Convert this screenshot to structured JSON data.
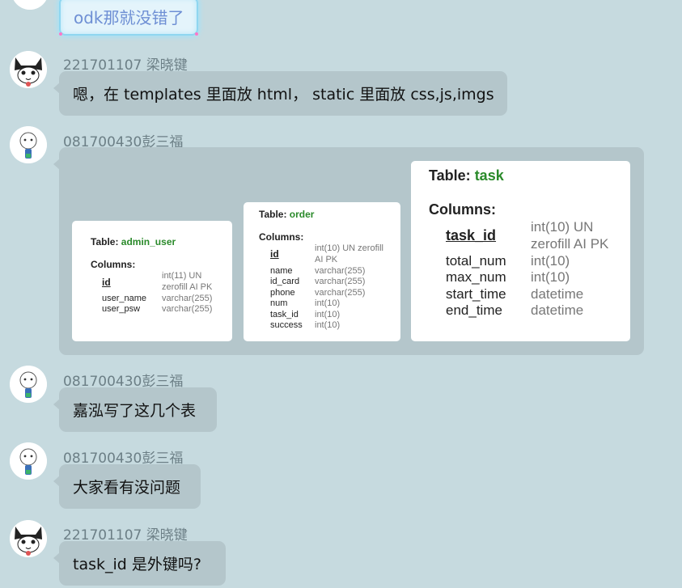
{
  "messages": [
    {
      "text": "odk那就没错了"
    },
    {
      "sender": "221701107 梁晓键",
      "text": "嗯，在 templates 里面放 html， static 里面放 css,js,imgs"
    },
    {
      "sender": "081700430彭三福"
    },
    {
      "sender": "081700430彭三福",
      "text": "嘉泓写了这几个表"
    },
    {
      "sender": "081700430彭三福",
      "text": "大家看有没问题"
    },
    {
      "sender": "221701107 梁晓键",
      "text": "task_id 是外键吗?"
    }
  ],
  "image": {
    "tables": [
      {
        "label": "Table:",
        "name": "admin_user",
        "columns_label": "Columns:",
        "columns": [
          {
            "name": "id",
            "type": "int(11) UN"
          },
          {
            "name": "",
            "type": "zerofill AI PK"
          },
          {
            "name": "user_name",
            "type": "varchar(255)"
          },
          {
            "name": "user_psw",
            "type": "varchar(255)"
          }
        ]
      },
      {
        "label": "Table:",
        "name": "order",
        "columns_label": "Columns:",
        "columns": [
          {
            "name": "id",
            "type": "int(10) UN zerofill"
          },
          {
            "name": "",
            "type": "AI PK"
          },
          {
            "name": "name",
            "type": "varchar(255)"
          },
          {
            "name": "id_card",
            "type": "varchar(255)"
          },
          {
            "name": "phone",
            "type": "varchar(255)"
          },
          {
            "name": "num",
            "type": "int(10)"
          },
          {
            "name": "task_id",
            "type": "int(10)"
          },
          {
            "name": "success",
            "type": "int(10)"
          }
        ]
      },
      {
        "label": "Table:",
        "name": "task",
        "columns_label": "Columns:",
        "columns": [
          {
            "name": "",
            "type": "int(10) UN"
          },
          {
            "name": "task_id",
            "type": "zerofill AI PK"
          },
          {
            "name": "total_num",
            "type": "int(10)"
          },
          {
            "name": "max_num",
            "type": "int(10)"
          },
          {
            "name": "start_time",
            "type": "datetime"
          },
          {
            "name": "end_time",
            "type": "datetime"
          }
        ]
      }
    ]
  },
  "colors": {
    "background": "#c6dadf",
    "bubble": "#b4c6cb",
    "table_name": "#2a8a2a",
    "sender": "#6c7f86"
  }
}
